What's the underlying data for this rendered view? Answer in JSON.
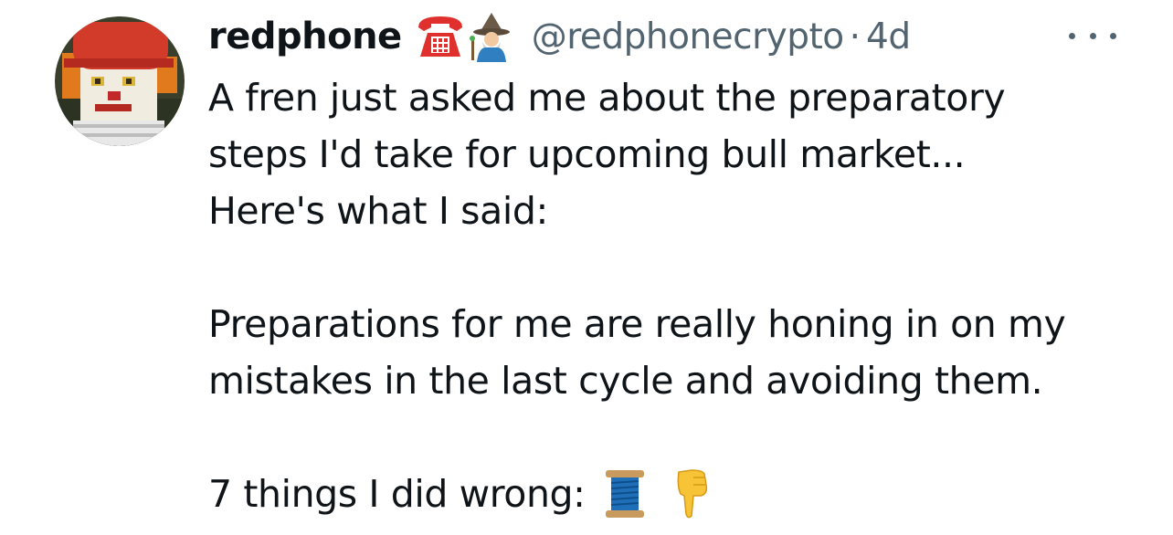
{
  "tweet": {
    "author_name": "redphone",
    "name_emoji_1": "telephone-icon",
    "name_emoji_2": "mage-icon",
    "handle": "@redphonecrypto",
    "separator": "·",
    "timestamp": "4d",
    "more_icon": "ellipsis-icon",
    "lines": [
      "A fren just asked me about the preparatory",
      "steps I'd take for upcoming bull market...",
      "Here's what I said:",
      "Preparations for me are really honing in on my",
      "mistakes in the last cycle and avoiding them.",
      "7 things I did wrong:"
    ],
    "trailing_emojis": [
      "thread-spool-icon",
      "pointing-down-icon"
    ]
  },
  "colors": {
    "text": "#0f1419",
    "secondary": "#536471",
    "telephone_red": "#e0302e",
    "avatar_red": "#d23a2a"
  }
}
